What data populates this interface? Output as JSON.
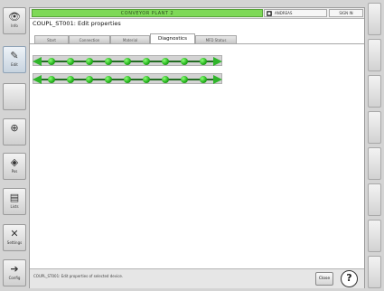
{
  "sidebar": {
    "items": [
      {
        "icon": "eye-icon",
        "glyph": "👁",
        "label": "Info"
      },
      {
        "icon": "pencil-icon",
        "glyph": "✎",
        "label": "Edit"
      },
      {
        "icon": "blank",
        "glyph": "",
        "label": ""
      },
      {
        "icon": "network-node-icon",
        "glyph": "⊕",
        "label": ""
      },
      {
        "icon": "route-diamond-icon",
        "glyph": "◈",
        "label": "Pos"
      },
      {
        "icon": "list-document-icon",
        "glyph": "▤",
        "label": "Lists"
      },
      {
        "icon": "tools-icon",
        "glyph": "✕",
        "label": "Settings"
      },
      {
        "icon": "config-arrow-icon",
        "glyph": "➔",
        "label": "Config"
      }
    ]
  },
  "header": {
    "plant_name": "CONVEYOR PLANT 2",
    "user_name": "ANDREAS",
    "logout_label": "SIGN IN"
  },
  "window": {
    "title": "COUPL_ST001: Edit properties",
    "tabs": [
      "Start",
      "Connection",
      "Material",
      "Diagnostics",
      "MFD Status"
    ],
    "active_tab": "Diagnostics"
  },
  "diagnostics": {
    "rows": [
      {
        "dots": 9,
        "status_color": "#22c41a"
      },
      {
        "dots": 9,
        "status_color": "#22c41a"
      }
    ]
  },
  "status": {
    "message": "COUPL_ST001: Edit properties of selected device.",
    "close_label": "Close",
    "help_label": "?"
  },
  "colors": {
    "plant_bar": "#7ed957",
    "status_ok": "#22c41a",
    "connector_line": "#246c24"
  }
}
